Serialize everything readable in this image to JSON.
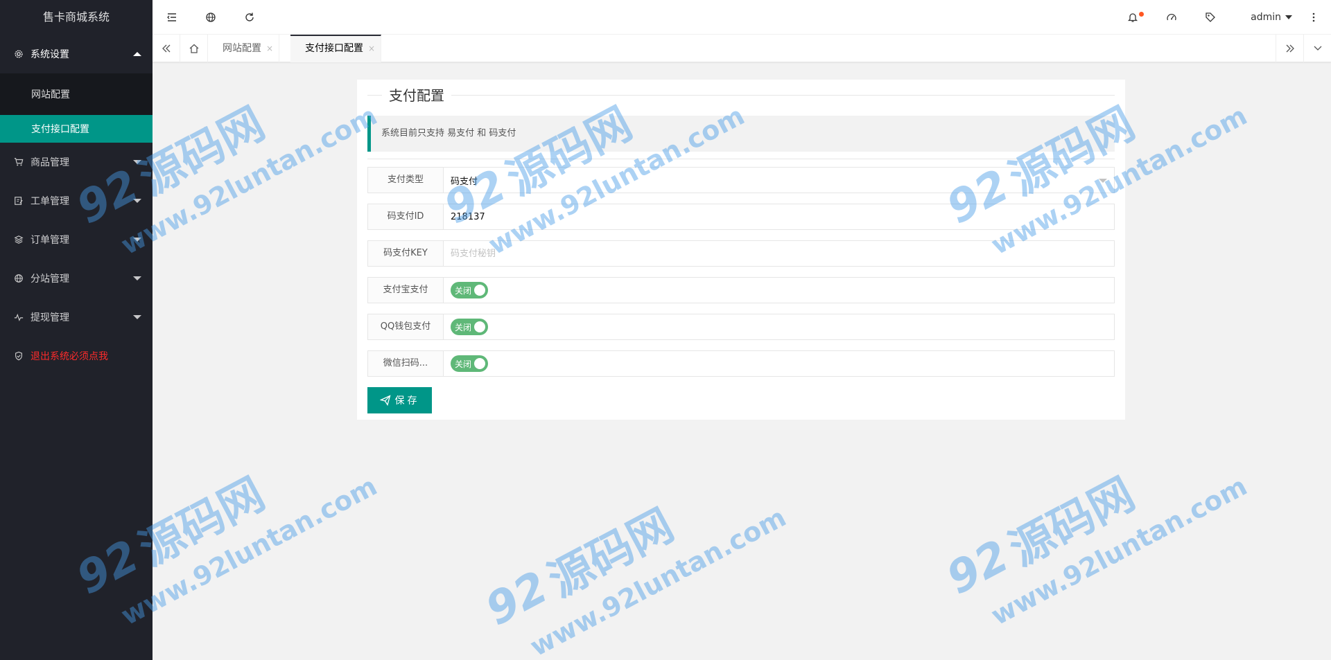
{
  "app": {
    "title": "售卡商城系统"
  },
  "sidebar": {
    "items": [
      {
        "label": "系统设置",
        "icon": "gear-icon",
        "open": true,
        "children": [
          {
            "label": "网站配置"
          },
          {
            "label": "支付接口配置",
            "active": true
          }
        ]
      },
      {
        "label": "商品管理",
        "icon": "cart-icon"
      },
      {
        "label": "工单管理",
        "icon": "ticket-icon"
      },
      {
        "label": "订单管理",
        "icon": "layers-icon"
      },
      {
        "label": "分站管理",
        "icon": "globe-icon"
      },
      {
        "label": "提现管理",
        "icon": "pulse-icon"
      },
      {
        "label": "退出系统必须点我",
        "icon": "shield-icon",
        "color": "#ff2b2b"
      }
    ]
  },
  "header": {
    "icons": [
      "menu-fold-icon",
      "globe-icon",
      "refresh-icon",
      "bell-icon",
      "dashboard-icon",
      "tag-icon",
      "more-vertical-icon"
    ],
    "user": "admin",
    "accent": "#ff5722"
  },
  "tabs": {
    "items": [
      {
        "label": "网站配置",
        "close": "×"
      },
      {
        "label": "支付接口配置",
        "close": "×",
        "active": true
      }
    ]
  },
  "form": {
    "legend": "支付配置",
    "notice": "系统目前只支持 易支付 和 码支付",
    "fields": [
      {
        "label": "支付类型",
        "type": "select",
        "value": "码支付"
      },
      {
        "label": "码支付ID",
        "type": "text",
        "value": "218137"
      },
      {
        "label": "码支付KEY",
        "type": "text",
        "value": "",
        "placeholder": "码支付秘钥"
      },
      {
        "label": "支付宝支付",
        "type": "switch",
        "value": "关闭"
      },
      {
        "label": "QQ钱包支付",
        "type": "switch",
        "value": "关闭"
      },
      {
        "label": "微信扫码...",
        "type": "switch",
        "value": "关闭"
      }
    ],
    "save_label": "保存",
    "accent": "#009688",
    "switch_color": "#5fb878"
  },
  "watermark": {
    "number": "92",
    "brand": "源码网",
    "url": "www.92luntan.com"
  }
}
